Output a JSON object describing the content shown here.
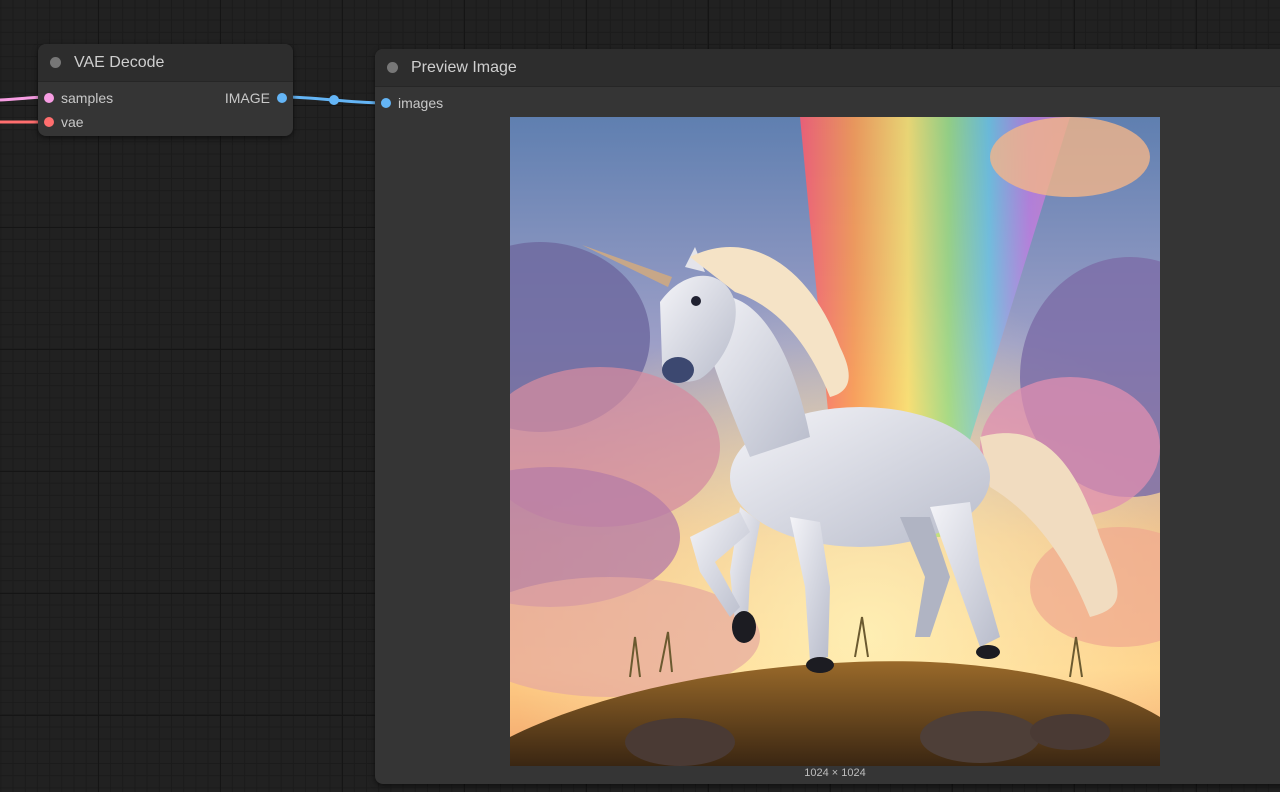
{
  "colors": {
    "samples_slot": "#f79de3",
    "vae_slot": "#ff6e6e",
    "image_slot": "#64b5f6",
    "link_image": "#64b5f6",
    "link_samples": "#f79de3",
    "link_vae": "#ff6e6e"
  },
  "vae_decode": {
    "title": "VAE Decode",
    "inputs": [
      {
        "label": "samples"
      },
      {
        "label": "vae"
      }
    ],
    "output": {
      "label": "IMAGE"
    }
  },
  "preview_image": {
    "title": "Preview Image",
    "input": {
      "label": "images"
    },
    "image_description": "unicorn on grassy hill with rainbow and sunset clouds",
    "dimensions": "1024 × 1024"
  }
}
